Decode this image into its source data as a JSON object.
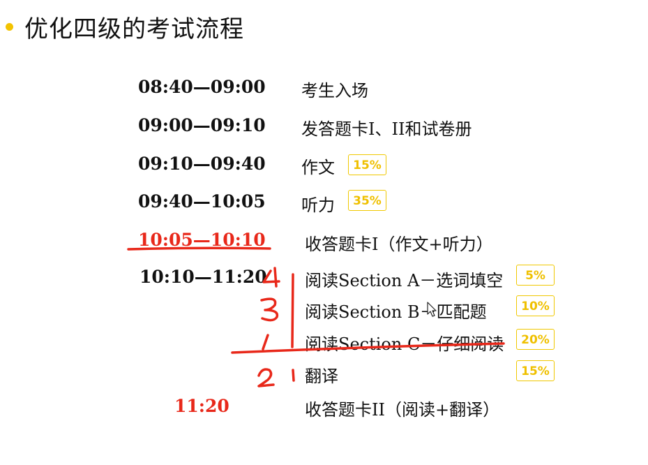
{
  "slide": {
    "title": "优化四级的考试流程",
    "rows": [
      {
        "time": "08:40—09:00",
        "desc": "考生入场",
        "badge": ""
      },
      {
        "time": "09:00—09:10",
        "desc": "发答题卡I、II和试卷册",
        "badge": ""
      },
      {
        "time": "09:10—09:40",
        "desc": "作文",
        "badge": "15%"
      },
      {
        "time": "09:40—10:05",
        "desc": "听力",
        "badge": "35%"
      },
      {
        "time": "10:05—10:10",
        "desc": "收答题卡I（作文+听力）",
        "badge": ""
      },
      {
        "time": "10:10—11:20",
        "desc": "阅读Section A－选词填空",
        "badge": "5%"
      },
      {
        "time": "",
        "desc": "阅读Section B－匹配题",
        "badge": "10%"
      },
      {
        "time": "",
        "desc": "阅读Section C－仔细阅读",
        "badge": "20%"
      },
      {
        "time": "",
        "desc": "翻译",
        "badge": "15%"
      },
      {
        "time": "11:20",
        "desc": "收答题卡II（阅读+翻译）",
        "badge": ""
      }
    ],
    "annotations": {
      "color": "#e8281a",
      "numbers": [
        "4",
        "3",
        "1",
        "2"
      ]
    },
    "colors": {
      "bullet": "#f3c300",
      "badge": "#efc000",
      "highlight_time": "#e8281a"
    }
  }
}
